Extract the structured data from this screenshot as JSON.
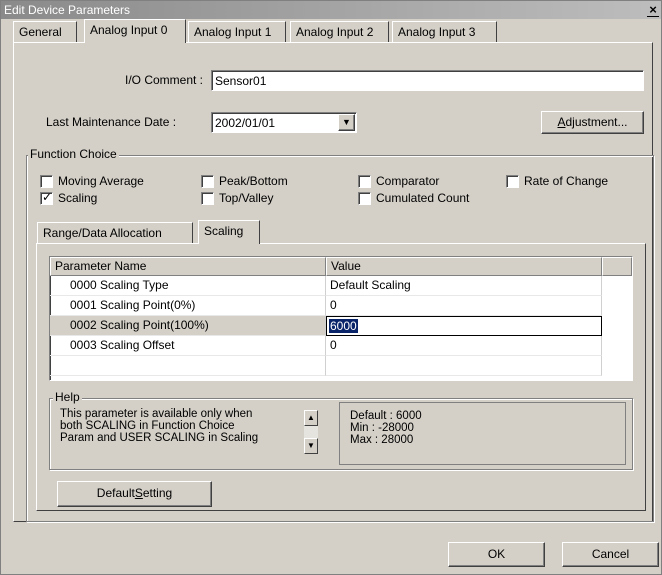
{
  "window": {
    "title": "Edit Device Parameters",
    "close_glyph": "×"
  },
  "tabs": [
    "General",
    "Analog Input 0",
    "Analog Input 1",
    "Analog Input 2",
    "Analog Input 3"
  ],
  "io_comment": {
    "label": "I/O Comment :",
    "value": "Sensor01"
  },
  "maintenance": {
    "label": "Last Maintenance Date :",
    "value": "2002/01/01",
    "dropdown_arrow": "▼"
  },
  "adjustment_button": {
    "label_pre": "",
    "label_acc": "A",
    "label_post": "djustment..."
  },
  "function_choice": {
    "title": "Function Choice",
    "items": [
      {
        "label": "Moving Average",
        "checked": false
      },
      {
        "label": "Peak/Bottom",
        "checked": false
      },
      {
        "label": "Comparator",
        "checked": false
      },
      {
        "label": "Rate of Change",
        "checked": false
      },
      {
        "label": "Scaling",
        "checked": true
      },
      {
        "label": "Top/Valley",
        "checked": false
      },
      {
        "label": "Cumulated Count",
        "checked": false
      }
    ],
    "checkmark_glyph": "✓"
  },
  "subtabs": [
    "Range/Data Allocation",
    "Scaling"
  ],
  "grid": {
    "headers": [
      "Parameter Name",
      "Value"
    ],
    "rows": [
      {
        "name": "0000 Scaling Type",
        "value": "Default Scaling"
      },
      {
        "name": "0001 Scaling Point(0%)",
        "value": "0"
      },
      {
        "name": "0002 Scaling Point(100%)",
        "value": "6000"
      },
      {
        "name": "0003 Scaling Offset",
        "value": "0"
      }
    ]
  },
  "help": {
    "title": "Help",
    "text_lines": [
      "This parameter is available only when",
      "both SCALING in Function Choice",
      "Param and USER SCALING in Scaling"
    ],
    "scroll_up_glyph": "▲",
    "scroll_down_glyph": "▼",
    "info_lines": [
      "Default : 6000",
      "Min : -28000",
      "Max : 28000"
    ]
  },
  "default_setting_button": {
    "label_pre": "Default ",
    "label_acc": "S",
    "label_post": "etting"
  },
  "footer": {
    "ok_label": "OK",
    "cancel_label": "Cancel"
  }
}
